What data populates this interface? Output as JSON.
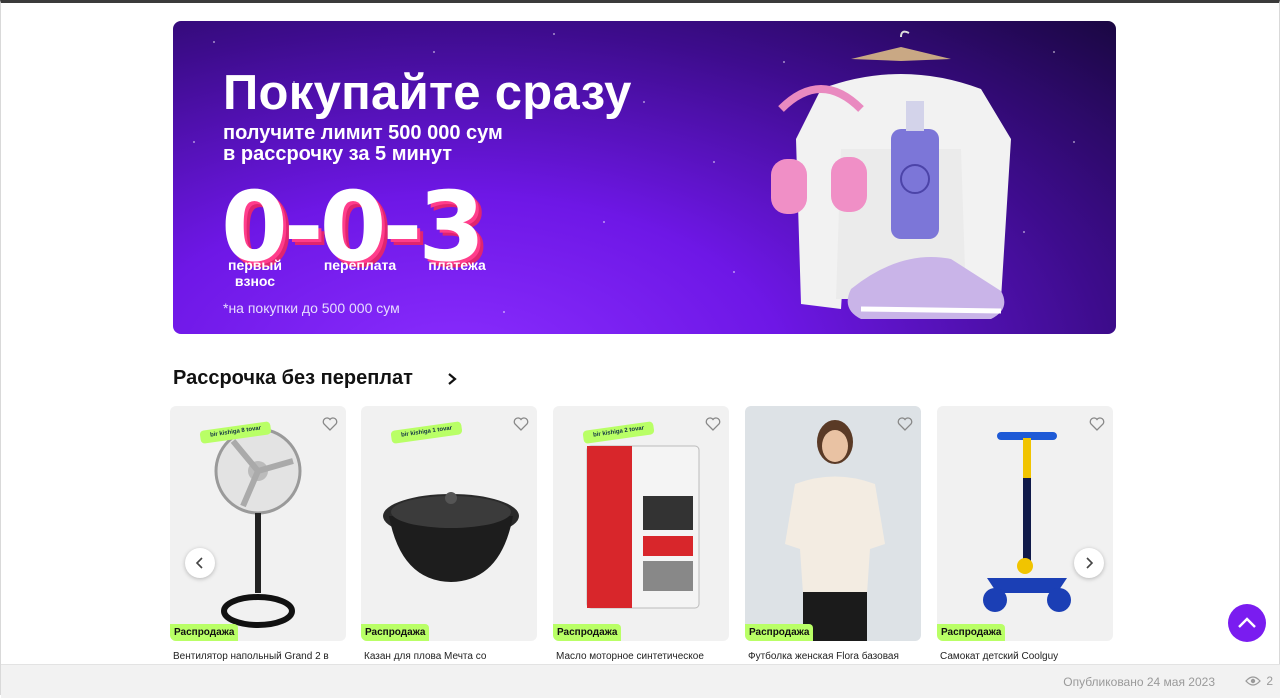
{
  "banner": {
    "title": "Покупайте сразу",
    "subtitle_line1": "получите лимит 500 000 сум",
    "subtitle_line2": "в рассрочку за 5 минут",
    "big_digits": "0-0-3",
    "label_first": "первый взнос",
    "label_overpay": "переплата",
    "label_payments": "платежа",
    "note": "*на покупки до 500 000 сум"
  },
  "section": {
    "title": "Рассрочка без переплат"
  },
  "products": [
    {
      "title": "Вентилятор напольный Grand 2 в",
      "tag": "bir kishiga 8 tovar",
      "sale": "Распродажа"
    },
    {
      "title": "Казан для плова Мечта со",
      "tag": "bir kishiga 1 tovar",
      "sale": "Распродажа"
    },
    {
      "title": "Масло моторное синтетическое",
      "tag": "bir kishiga 2 tovar",
      "sale": "Распродажа"
    },
    {
      "title": "Футболка женская Flora базовая",
      "tag": "",
      "sale": "Распродажа"
    },
    {
      "title": "Самокат детский Coolguy",
      "tag": "",
      "sale": "Распродажа"
    }
  ],
  "footer": {
    "published": "Опубликовано 24 мая 2023",
    "views": "2"
  },
  "colors": {
    "accent": "#7a1cf0",
    "sale_badge": "#b9ff66",
    "banner_bg": "#6e17e6"
  },
  "icons": [
    "heart-icon",
    "chevron-left-icon",
    "chevron-right-icon",
    "arrow-up-icon",
    "eye-icon"
  ]
}
